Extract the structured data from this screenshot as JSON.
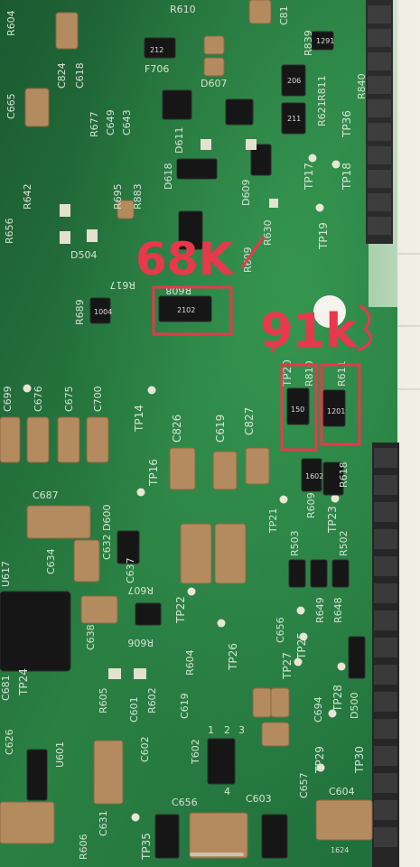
{
  "annotations": {
    "left_value": "68K",
    "right_value": "91k",
    "colors": {
      "annotation": "#e8384b"
    }
  },
  "silkscreen": {
    "top": [
      "R604",
      "R610",
      "C81",
      "R839",
      "R811",
      "R840",
      "C665",
      "C824",
      "C618",
      "F706",
      "D607",
      "R621",
      "TP36",
      "R677",
      "C649",
      "C643",
      "D611",
      "D618",
      "R695",
      "R883",
      "TP17",
      "TP18",
      "R656",
      "R642",
      "D504",
      "D609",
      "R630",
      "R609",
      "TP19"
    ],
    "middle": [
      "R689",
      "R617",
      "R608",
      "TP20",
      "R810",
      "R611",
      "C699",
      "C676",
      "C675",
      "C700",
      "TP14",
      "C826",
      "C619",
      "C827",
      "TP16",
      "R618",
      "C687",
      "C632",
      "D600",
      "R609",
      "TP23",
      "TP21",
      "R503",
      "R502"
    ],
    "bottom": [
      "C634",
      "C637",
      "U617",
      "R607",
      "C638",
      "TP22",
      "R606",
      "TP26",
      "C656",
      "R648",
      "R649",
      "TP25",
      "R604",
      "C681",
      "TP24",
      "TP27",
      "TP28",
      "D500",
      "R605",
      "R602",
      "C601",
      "C619",
      "C602",
      "T602",
      "C694",
      "TP29",
      "TP30",
      "C626",
      "U601",
      "C631",
      "C656",
      "C603",
      "C657",
      "C604",
      "TP35",
      "R606",
      "1",
      "2",
      "3",
      "4"
    ]
  },
  "component_labels": [
    "212",
    "206",
    "211",
    "2102",
    "150",
    "1201",
    "1602",
    "1291",
    "1004",
    "1624"
  ],
  "colors": {
    "pcb": "#1f6b3a",
    "pcb_light": "#2b8a47",
    "silkscreen": "#d7e3d3",
    "resistor": "#1a1a1a",
    "capacitor": "#b68a5e",
    "connector": "#2a2a2a",
    "background": "#eae6dd"
  }
}
